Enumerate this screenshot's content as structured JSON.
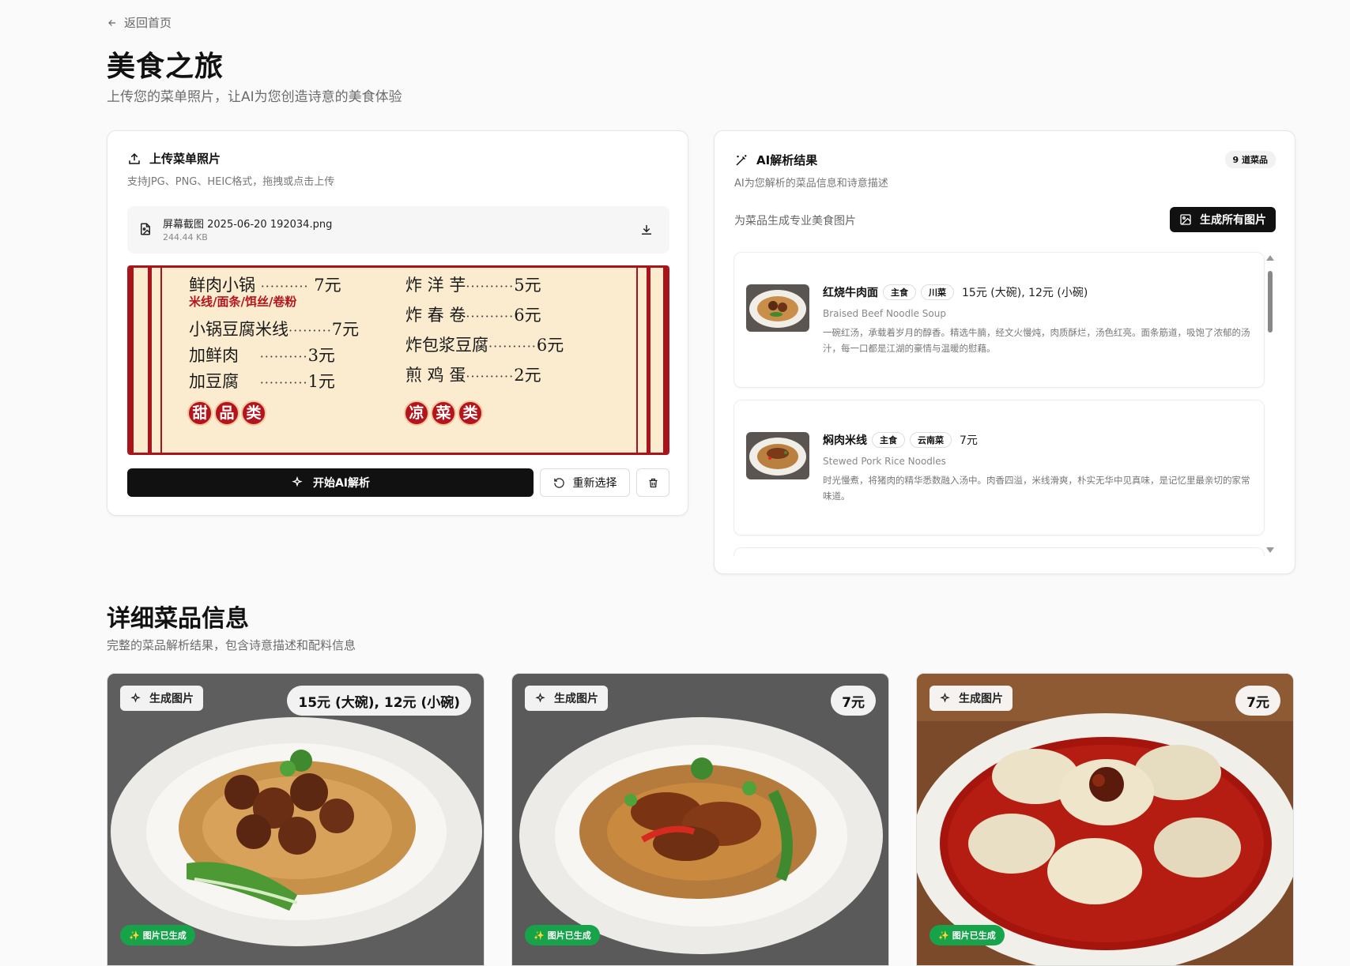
{
  "nav": {
    "back_label": "返回首页"
  },
  "page": {
    "title": "美食之旅",
    "subtitle": "上传您的菜单照片，让AI为您创造诗意的美食体验"
  },
  "upload": {
    "heading": "上传菜单照片",
    "hint": "支持JPG、PNG、HEIC格式，拖拽或点击上传",
    "file_name": "屏幕截图 2025-06-20 192034.png",
    "file_size": "244.44 KB",
    "menu_image": {
      "left_items": [
        {
          "name": "鲜肉小锅",
          "dots": "··········",
          "price": "7元"
        },
        {
          "name": "小锅豆腐米线",
          "dots": "·········",
          "price": "7元"
        },
        {
          "name": "加鲜肉",
          "dots": "··········",
          "price": "3元"
        },
        {
          "name": "加豆腐",
          "dots": "··········",
          "price": "1元"
        }
      ],
      "left_sub": "米线/面条/饵丝/卷粉",
      "right_items": [
        {
          "name": "炸 洋 芋",
          "dots": "··········",
          "price": "5元"
        },
        {
          "name": "炸 春 卷",
          "dots": "··········",
          "price": "6元"
        },
        {
          "name": "炸包浆豆腐",
          "dots": "··········",
          "price": "6元"
        },
        {
          "name": "煎 鸡 蛋",
          "dots": "··········",
          "price": "2元"
        }
      ],
      "left_seals": [
        "甜",
        "品",
        "类"
      ],
      "right_seals": [
        "凉",
        "菜",
        "类"
      ]
    },
    "analyze_label": "开始AI解析",
    "reselect_label": "重新选择"
  },
  "ai": {
    "heading": "AI解析结果",
    "count_badge": "9 道菜品",
    "hint": "AI为您解析的菜品信息和诗意描述",
    "gen_label": "为菜品生成专业美食图片",
    "gen_all_label": "生成所有图片",
    "dishes": [
      {
        "name": "红烧牛肉面",
        "tag1": "主食",
        "tag2": "川菜",
        "price": "15元 (大碗), 12元 (小碗)",
        "english": "Braised Beef Noodle Soup",
        "desc": "一碗红汤，承载着岁月的醇香。精选牛腩，经文火慢炖，肉质酥烂，汤色红亮。面条筋道，吸饱了浓郁的汤汁，每一口都是江湖的豪情与温暖的慰藉。"
      },
      {
        "name": "焖肉米线",
        "tag1": "主食",
        "tag2": "云南菜",
        "price": "7元",
        "english": "Stewed Pork Rice Noodles",
        "desc": "时光慢煮，将猪肉的精华悉数融入汤中。肉香四溢，米线滑爽，朴实无华中见真味，是记忆里最亲切的家常味道。"
      }
    ]
  },
  "details": {
    "title": "详细菜品信息",
    "subtitle": "完整的菜品解析结果，包含诗意描述和配料信息",
    "gen_btn_label": "生成图片",
    "gen_done_label": "图片已生成",
    "cards": [
      {
        "price": "15元 (大碗), 12元 (小碗)"
      },
      {
        "price": "7元"
      },
      {
        "price": "7元"
      }
    ]
  },
  "colors": {
    "menu_red": "#a9141b",
    "menu_bg": "#fbecd0",
    "success": "#16a34a",
    "primary": "#111111"
  }
}
